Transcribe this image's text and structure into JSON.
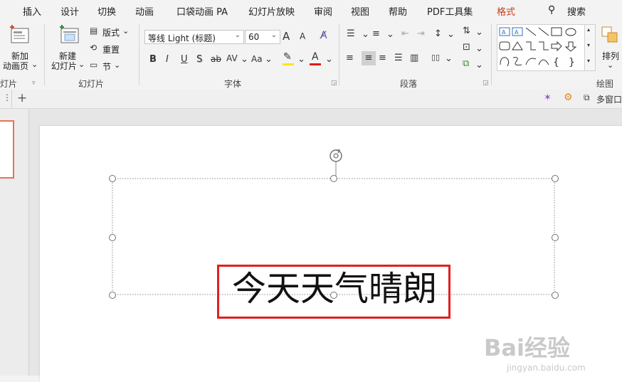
{
  "menubar": {
    "tabs": [
      "插入",
      "设计",
      "切换",
      "动画",
      "口袋动画 PA",
      "幻灯片放映",
      "审阅",
      "视图",
      "帮助",
      "PDF工具集",
      "格式"
    ],
    "search_label": "搜索"
  },
  "ribbon": {
    "new_animation_line1": "新加",
    "new_animation_line2": "动画页",
    "group_animation": "灯片",
    "new_slide_line1": "新建",
    "new_slide_line2": "幻灯片",
    "layout_label": "版式",
    "reset_label": "重置",
    "section_label": "节",
    "group_slides": "幻灯片",
    "font_name": "等线 Light (标题)",
    "font_size": "60",
    "font_grow": "A",
    "font_shrink": "A",
    "bold": "B",
    "italic": "I",
    "underline": "U",
    "shadow": "S",
    "strikethrough": "ab",
    "char_spacing": "AV",
    "change_case": "Aa",
    "font_color": "A",
    "group_font": "字体",
    "group_paragraph": "段落",
    "arrange_label": "排列",
    "group_drawing": "绘图"
  },
  "tabstrip": {
    "add_tab": "+",
    "multi_window": "多窗口"
  },
  "slide": {
    "title_text": "今天天气晴朗"
  },
  "watermark": {
    "logo": "Bai经验",
    "url": "jingyan.baidu.com"
  },
  "colors": {
    "accent": "#c43e1c",
    "selection_box": "#e02020",
    "highlight_yellow": "#ffe600",
    "font_color_red": "#e01b1b"
  }
}
